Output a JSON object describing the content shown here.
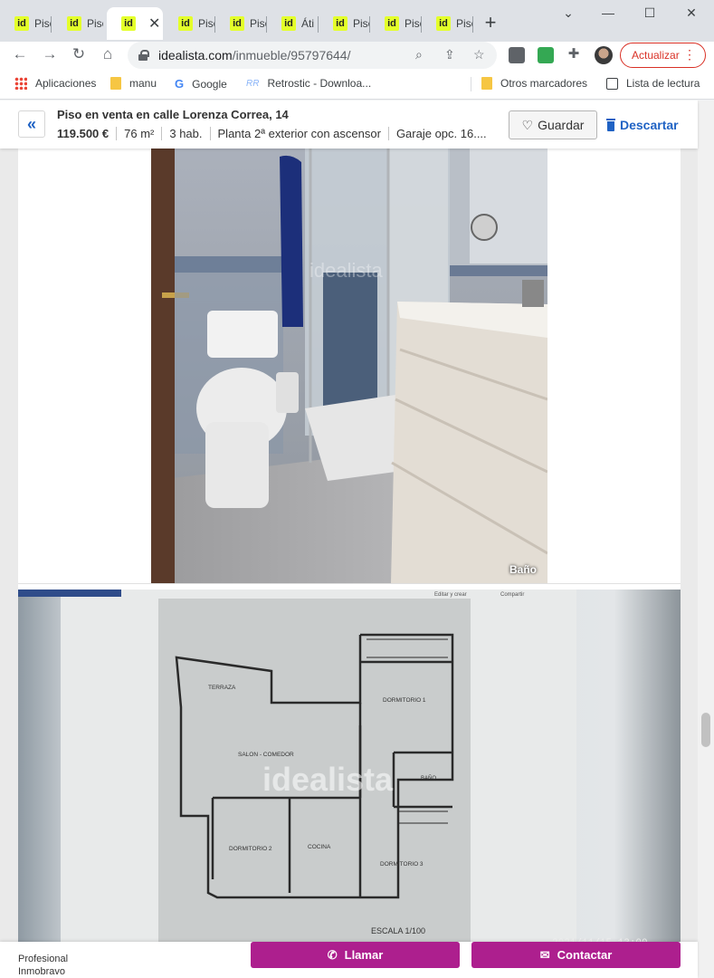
{
  "browser": {
    "tabs": [
      {
        "favicon": "id",
        "label": "Piso"
      },
      {
        "favicon": "id",
        "label": "Piso"
      },
      {
        "favicon": "id",
        "label": ""
      },
      {
        "favicon": "id",
        "label": "Piso"
      },
      {
        "favicon": "id",
        "label": "Piso"
      },
      {
        "favicon": "id",
        "label": "Áti"
      },
      {
        "favicon": "id",
        "label": "Piso"
      },
      {
        "favicon": "id",
        "label": "Piso"
      },
      {
        "favicon": "id",
        "label": "Piso"
      }
    ],
    "url_host": "idealista.com",
    "url_path": "/inmueble/95797644/",
    "update_label": "Actualizar",
    "bookmarks": {
      "apps": "Aplicaciones",
      "manu": "manu",
      "google": "Google",
      "retrostic": "Retrostic - Downloa...",
      "other": "Otros marcadores",
      "reading_list": "Lista de lectura"
    }
  },
  "listing": {
    "title": "Piso en venta en calle Lorenza Correa, 14",
    "price": "119.500 €",
    "area": "76 m²",
    "rooms": "3 hab.",
    "floor": "Planta 2ª exterior con ascensor",
    "garage": "Garaje opc. 16....",
    "save_label": "Guardar",
    "discard_label": "Descartar"
  },
  "photos": {
    "photo1_caption": "Baño",
    "watermark": "idealista",
    "floorplan": {
      "toolbar_edit": "Editar y crear",
      "toolbar_share": "Compartir",
      "rooms": {
        "terraza": "TERRAZA",
        "dorm1": "DORMITORIO 1",
        "salon": "SALON - COMEDOR",
        "bano": "BAÑO",
        "dorm2": "DORMITORIO 2",
        "cocina": "COCINA",
        "dorm3": "DORMITORIO 3"
      },
      "scale": "ESCALA 1/100",
      "timestamp": "2021/11/15 13:00"
    }
  },
  "footer": {
    "agent_line1": "Profesional",
    "agent_line2": "Inmobravo",
    "call_label": "Llamar",
    "contact_label": "Contactar"
  },
  "colors": {
    "accent_blue": "#1f62c4",
    "cta_magenta": "#ad1f8e",
    "favicon_yellow": "#e4ff2a"
  }
}
